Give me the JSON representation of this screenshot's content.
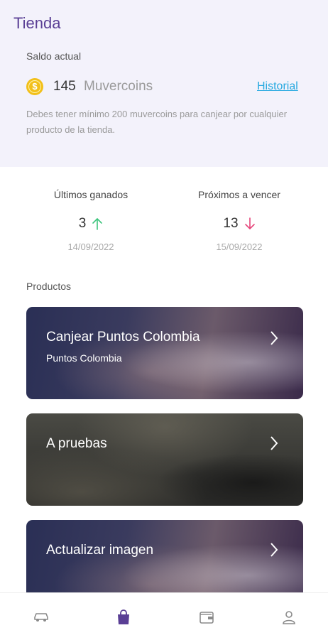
{
  "header": {
    "title": "Tienda",
    "balance_label": "Saldo actual",
    "balance_amount": "145",
    "balance_unit": "Muvercoins",
    "coin_symbol": "$",
    "history_link": "Historial",
    "note": "Debes tener mínimo 200 muvercoins para canjear por cualquier producto de la tienda."
  },
  "stats": {
    "earned": {
      "label": "Últimos ganados",
      "value": "3",
      "date": "14/09/2022",
      "arrow": "arrow-up-icon"
    },
    "expiring": {
      "label": "Próximos a vencer",
      "value": "13",
      "date": "15/09/2022",
      "arrow": "arrow-down-icon"
    }
  },
  "products": {
    "label": "Productos",
    "items": [
      {
        "title": "Canjear Puntos Colombia",
        "subtitle": "Puntos Colombia"
      },
      {
        "title": "A pruebas",
        "subtitle": ""
      },
      {
        "title": "Actualizar imagen",
        "subtitle": ""
      }
    ]
  },
  "nav": {
    "items": [
      "car-icon",
      "shopping-bag-icon",
      "wallet-icon",
      "user-icon"
    ],
    "active": "shopping-bag-icon"
  },
  "colors": {
    "accent": "#5a3f95",
    "link": "#27a9e0",
    "up": "#3cc47c",
    "down": "#e6467b",
    "header_bg": "#f3f2fb"
  }
}
